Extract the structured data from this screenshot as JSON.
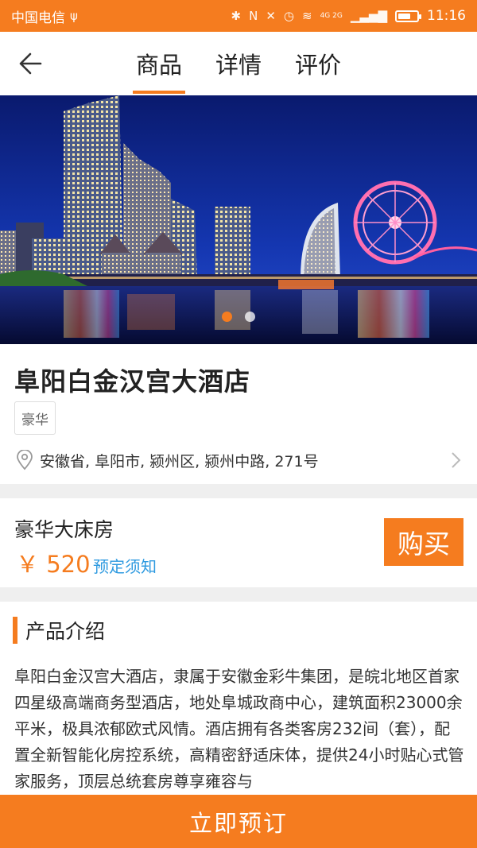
{
  "status_bar": {
    "carrier": "中国电信",
    "network": "4G 2G",
    "time": "11:16",
    "battery_level": 0.7,
    "icons": [
      "usb-icon",
      "bluetooth-icon",
      "nfc-icon",
      "mute-icon",
      "alarm-icon",
      "wifi-icon",
      "signal-icon",
      "battery-icon"
    ]
  },
  "header": {
    "back_icon": "back-arrow-icon",
    "tabs": [
      {
        "label": "商品",
        "active": true
      },
      {
        "label": "详情",
        "active": false
      },
      {
        "label": "评价",
        "active": false
      }
    ]
  },
  "banner": {
    "slide_count": 2,
    "active_slide": 1
  },
  "hotel": {
    "name": "阜阳白金汉宫大酒店",
    "tag": "豪华",
    "address": "安徽省, 阜阳市, 颍州区, 颍州中路, 271号",
    "location_icon": "location-pin-icon",
    "chevron_icon": "chevron-right-icon"
  },
  "room": {
    "name": "豪华大床房",
    "price": "￥ 520",
    "notice_link": "预定须知",
    "buy_label": "购买"
  },
  "intro": {
    "title": "产品介绍",
    "text": "阜阳白金汉宫大酒店，隶属于安徽金彩牛集团，是皖北地区首家四星级高端商务型酒店，地处阜城政商中心，建筑面积23000余平米，极具浓郁欧式风情。酒店拥有各类客房232间（套），配置全新智能化房控系统，高精密舒适床体，提供24小时贴心式管家服务，顶层总统套房尊享雍容与"
  },
  "bottom_bar": {
    "book_label": "立即预订"
  },
  "colors": {
    "accent": "#f57c1f",
    "link": "#2e9ae0",
    "background": "#efefef"
  }
}
